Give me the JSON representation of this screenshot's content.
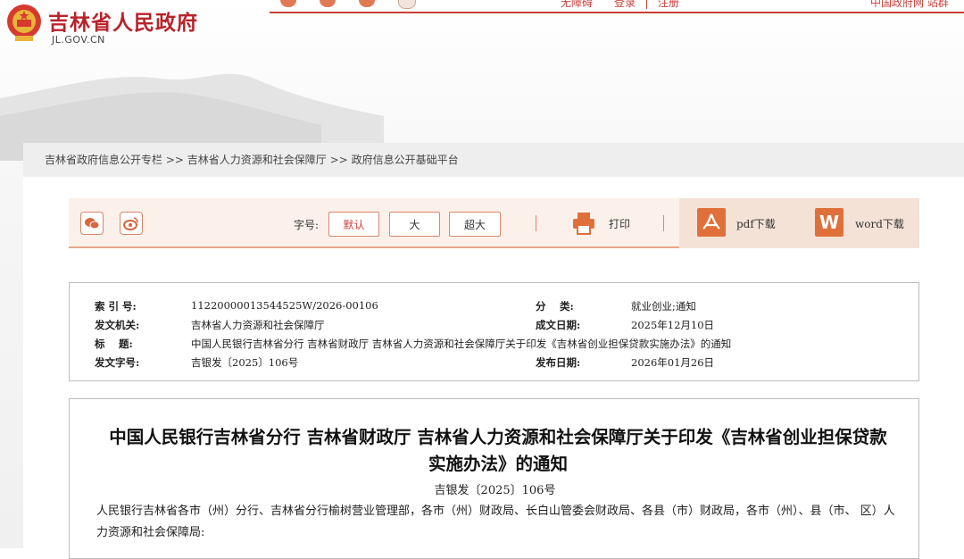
{
  "header": {
    "site_name": "吉林省人民政府",
    "site_domain": "JL.GOV.CN",
    "top_links": [
      "无障碍",
      "登录",
      "注册"
    ],
    "top_right": "中国政府网   站群"
  },
  "breadcrumb": {
    "items": [
      "吉林省政府信息公开专栏",
      "吉林省人力资源和社会保障厅",
      "政府信息公开基础平台"
    ],
    "sep": ">>"
  },
  "toolbar": {
    "font_label": "字号:",
    "font_sizes": [
      "默认",
      "大",
      "超大"
    ],
    "print_label": "打印",
    "pdf_label": "pdf下载",
    "word_label": "word下载",
    "colors": {
      "accent": "#c8403a",
      "border": "#d9866a",
      "bg": "#fbf1ea"
    }
  },
  "meta": {
    "index_no_label": "索 引 号:",
    "index_no": "11220000013544525W/2026-00106",
    "category_label": "分　 类:",
    "category": "就业创业;通知",
    "issuer_label": "发文机关:",
    "issuer": "吉林省人力资源和社会保障厅",
    "written_date_label": "成文日期:",
    "written_date": "2025年12月10日",
    "title_label": "标　 题:",
    "title": "中国人民银行吉林省分行 吉林省财政厅 吉林省人力资源和社会保障厅关于印发《吉林省创业担保贷款实施办法》的通知",
    "doc_no_label": "发文字号:",
    "doc_no": "吉银发〔2025〕106号",
    "publish_date_label": "发布日期:",
    "publish_date": "2026年01月26日"
  },
  "article": {
    "title": "中国人民银行吉林省分行 吉林省财政厅 吉林省人力资源和社会保障厅关于印发《吉林省创业担保贷款实施办法》的通知",
    "doc_no": "吉银发〔2025〕106号",
    "body": "人民银行吉林省各市（州）分行、吉林省分行榆树营业管理部，各市（州）财政局、长白山管委会财政局、各县（市）财政局，各市（州）、县（市、 区）人力资源和社会保障局:"
  }
}
